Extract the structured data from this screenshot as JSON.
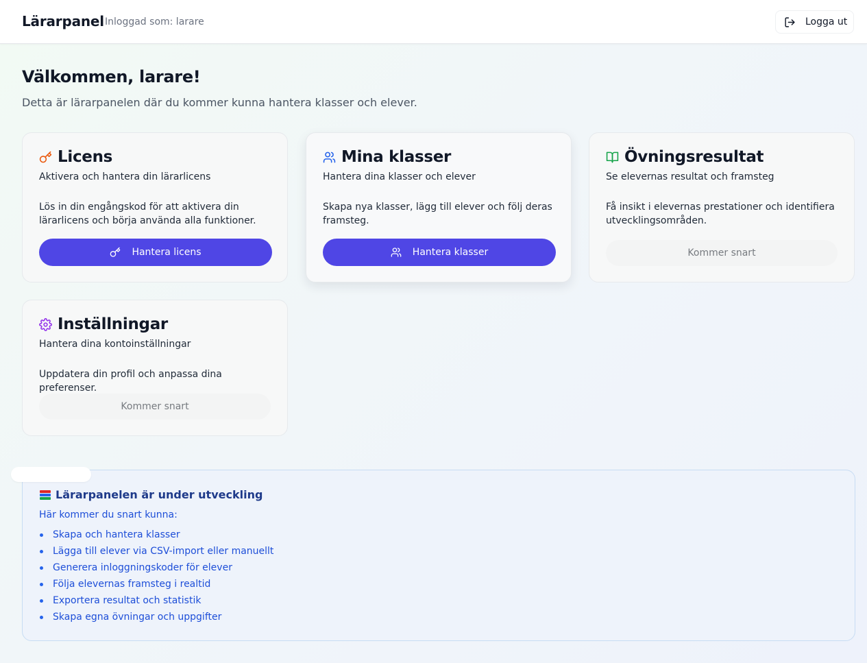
{
  "header": {
    "title": "Lärarpanel",
    "logged_in_as": "Inloggad som: larare",
    "logout_label": "Logga ut"
  },
  "welcome": {
    "title": "Välkommen, larare!",
    "intro": "Detta är lärarpanelen där du kommer kunna hantera klasser och elever."
  },
  "cards": [
    {
      "title": "Licens",
      "subtitle": "Aktivera och hantera din lärarlicens",
      "description": "Lös in din engångskod för att aktivera din lärarlicens och börja använda alla funktioner.",
      "button": "Hantera licens",
      "icon": "key-icon",
      "icon_color": "#ea580c"
    },
    {
      "title": "Mina klasser",
      "subtitle": "Hantera dina klasser och elever",
      "description": "Skapa nya klasser, lägg till elever och följ deras framsteg.",
      "button": "Hantera klasser",
      "icon": "users-icon",
      "icon_color": "#2563eb"
    },
    {
      "title": "Övningsresultat",
      "subtitle": "Se elevernas resultat och framsteg",
      "description": "Få insikt i elevernas prestationer och identifiera utvecklingsområden.",
      "button": "Kommer snart",
      "icon": "book-open-icon",
      "icon_color": "#16a34a"
    },
    {
      "title": "Inställningar",
      "subtitle": "Hantera dina kontoinställningar",
      "description": "Uppdatera din profil och anpassa dina preferenser.",
      "button": "Kommer snart",
      "icon": "settings-icon",
      "icon_color": "#9333ea"
    }
  ],
  "dev_notice": {
    "title": "Lärarpanelen är under utveckling",
    "intro": "Här kommer du snart kunna:",
    "items": [
      "Skapa och hantera klasser",
      "Lägga till elever via CSV-import eller manuellt",
      "Generera inloggningskoder för elever",
      "Följa elevernas framsteg i realtid",
      "Exportera resultat och statistik",
      "Skapa egna övningar och uppgifter"
    ]
  },
  "colors": {
    "primary": "#4f46e5",
    "notice_text": "#1d4ed8",
    "notice_title": "#1e3a8a"
  }
}
